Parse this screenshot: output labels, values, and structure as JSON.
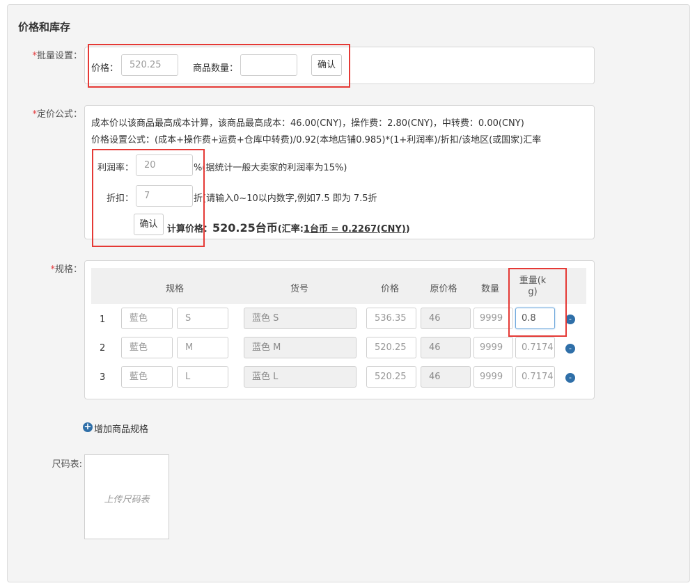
{
  "section_title": "价格和库存",
  "batch": {
    "label": "批量设置：",
    "price_label": "价格：",
    "price_value": "520.25",
    "qty_label": "商品数量：",
    "qty_value": "",
    "confirm": "确认"
  },
  "formula": {
    "label": "定价公式：",
    "line1": "成本价以该商品最高成本计算，该商品最高成本：46.00(CNY)，操作费：2.80(CNY)，中转费：0.00(CNY)",
    "line2": "价格设置公式：(成本+操作费+运费+仓库中转费)/0.92(本地店铺0.985)*(1+利润率)/折扣/该地区(或国家)汇率",
    "profit_label": "利润率：",
    "profit_value": "20",
    "profit_hint": "%(据统计一般大卖家的利润率为15%)",
    "discount_label": "折扣：",
    "discount_value": "7",
    "discount_hint": "折(请输入0~10以内数字,例如7.5 即为 7.5折",
    "confirm": "确认",
    "calc_label": "计算价格：",
    "calc_price": "520.25台币",
    "rate_prefix": "(汇率:",
    "rate_value": "1台币 = 0.2267(CNY)",
    "rate_suffix": ")"
  },
  "spec": {
    "label": "规格：",
    "headers": {
      "spec": "规格",
      "sku": "货号",
      "price": "价格",
      "orig_price": "原价格",
      "qty": "数量",
      "weight": "重量(kg)"
    },
    "rows": [
      {
        "no": "1",
        "color": "藍色",
        "size": "S",
        "sku": "蓝色 S",
        "price": "536.35",
        "orig": "46",
        "qty": "9999",
        "weight": "0.8"
      },
      {
        "no": "2",
        "color": "藍色",
        "size": "M",
        "sku": "蓝色 M",
        "price": "520.25",
        "orig": "46",
        "qty": "9999",
        "weight": "0.7174"
      },
      {
        "no": "3",
        "color": "藍色",
        "size": "L",
        "sku": "蓝色 L",
        "price": "520.25",
        "orig": "46",
        "qty": "9999",
        "weight": "0.7174"
      }
    ],
    "remove_symbol": "-",
    "add_label": "增加商品规格",
    "add_symbol": "+"
  },
  "size_chart": {
    "label": "尺码表:",
    "upload_text": "上传尺码表"
  },
  "colors": {
    "required": "#e4393c",
    "highlight": "#e53935",
    "accent": "#2f6fa8"
  }
}
